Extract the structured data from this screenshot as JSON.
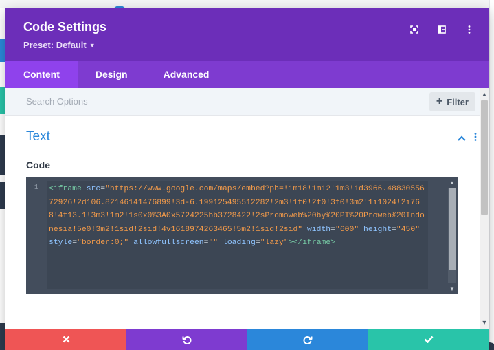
{
  "modal": {
    "title": "Code Settings",
    "preset_label": "Preset: Default",
    "header_icons": [
      "expand-icon",
      "split-view-icon",
      "more-vertical-icon"
    ]
  },
  "tabs": [
    {
      "label": "Content",
      "active": true
    },
    {
      "label": "Design",
      "active": false
    },
    {
      "label": "Advanced",
      "active": false
    }
  ],
  "search": {
    "placeholder": "Search Options",
    "filter_label": "Filter"
  },
  "section": {
    "title": "Text",
    "field_label": "Code"
  },
  "editor": {
    "line_number": "1",
    "code_tokens": [
      {
        "t": "tag",
        "v": "<iframe"
      },
      {
        "t": "sp",
        "v": " "
      },
      {
        "t": "attr",
        "v": "src"
      },
      {
        "t": "eq",
        "v": "="
      },
      {
        "t": "str",
        "v": "\"https://www.google.com/maps/embed?pb=!1m18!1m12!1m3!1d3966.4883055672926!2d106.82146141476899!3d-6.199125495512282!2m3!1f0!2f0!3f0!3m2!1i1024!2i768!4f13.1!3m3!1m2!1s0x0%3A0x5724225bb3728422!2sPromoweb%20by%20PT%20Proweb%20Indonesia!5e0!3m2!1sid!2sid!4v1618974263465!5m2!1sid!2sid\""
      },
      {
        "t": "sp",
        "v": " "
      },
      {
        "t": "attr",
        "v": "width"
      },
      {
        "t": "eq",
        "v": "="
      },
      {
        "t": "str",
        "v": "\"600\""
      },
      {
        "t": "sp",
        "v": " "
      },
      {
        "t": "attr",
        "v": "height"
      },
      {
        "t": "eq",
        "v": "="
      },
      {
        "t": "str",
        "v": "\"450\""
      },
      {
        "t": "sp",
        "v": " "
      },
      {
        "t": "attr",
        "v": "style"
      },
      {
        "t": "eq",
        "v": "="
      },
      {
        "t": "str",
        "v": "\"border:0;\""
      },
      {
        "t": "sp",
        "v": " "
      },
      {
        "t": "attr",
        "v": "allowfullscreen"
      },
      {
        "t": "eq",
        "v": "="
      },
      {
        "t": "str",
        "v": "\"\""
      },
      {
        "t": "sp",
        "v": " "
      },
      {
        "t": "attr",
        "v": "loading"
      },
      {
        "t": "eq",
        "v": "="
      },
      {
        "t": "str",
        "v": "\"lazy\""
      },
      {
        "t": "tag",
        "v": ">"
      },
      {
        "t": "tag",
        "v": "</iframe>"
      }
    ]
  },
  "footer": {
    "buttons": [
      {
        "name": "discard-button",
        "icon": "close-icon",
        "color": "#ef5555"
      },
      {
        "name": "undo-button",
        "icon": "undo-icon",
        "color": "#7e3bd0"
      },
      {
        "name": "redo-button",
        "icon": "redo-icon",
        "color": "#2b87da"
      },
      {
        "name": "save-button",
        "icon": "check-icon",
        "color": "#29c4a9"
      }
    ]
  },
  "colors": {
    "header": "#6c2eb9",
    "tabs": "#7e3bd0",
    "active_tab": "#8f42ec",
    "accent": "#2b87da"
  }
}
